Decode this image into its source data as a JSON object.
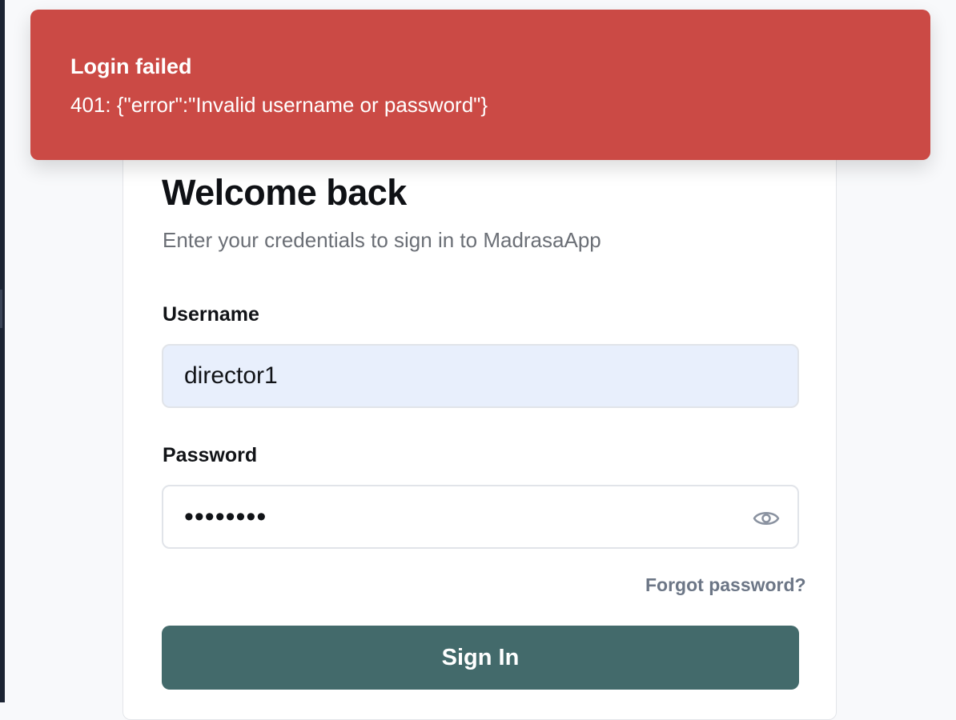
{
  "toast": {
    "title": "Login failed",
    "message": "401: {\"error\":\"Invalid username or password\"}",
    "background": "#cb4a45"
  },
  "login": {
    "title": "Welcome back",
    "subtitle": "Enter your credentials to sign in to MadrasaApp",
    "username_label": "Username",
    "username_value": "director1",
    "password_label": "Password",
    "password_value": "••••••••",
    "forgot_link": "Forgot password?",
    "submit_label": "Sign In",
    "accent": "#436a6b"
  },
  "icons": {
    "password_toggle": "eye-icon"
  }
}
